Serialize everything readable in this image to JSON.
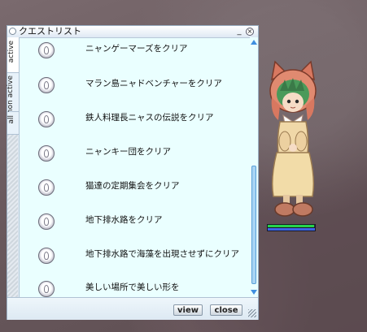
{
  "window": {
    "title": "クエストリスト",
    "minimize_glyph": "_",
    "close_glyph": "×"
  },
  "tabs": [
    {
      "label": "active"
    },
    {
      "label": "non active"
    },
    {
      "label": "all"
    }
  ],
  "quests": [
    {
      "title": "ニャンゲーマーズをクリア",
      "icon": "quest-icon"
    },
    {
      "title": "マラン島ニャドベンチャーをクリア",
      "icon": "quest-icon"
    },
    {
      "title": "鉄人料理長ニャスの伝説をクリア",
      "icon": "quest-icon"
    },
    {
      "title": "ニャンキー団をクリア",
      "icon": "quest-icon"
    },
    {
      "title": "猫達の定期集会をクリア",
      "icon": "quest-icon"
    },
    {
      "title": "地下排水路をクリア",
      "icon": "quest-icon"
    },
    {
      "title": "地下排水路で海藻を出現させずにクリア",
      "icon": "quest-icon"
    },
    {
      "title": "美しい場所で美しい形を",
      "icon": "quest-icon"
    }
  ],
  "buttons": {
    "view_label": "view",
    "close_label": "close"
  },
  "player": {
    "hp_fraction": 0.98,
    "sp_fraction": 1.0
  },
  "colors": {
    "window_bg": "#eaffff",
    "hp": "#25d34a",
    "sp": "#3c64e6",
    "scroll_accent": "#3f8fe0"
  }
}
